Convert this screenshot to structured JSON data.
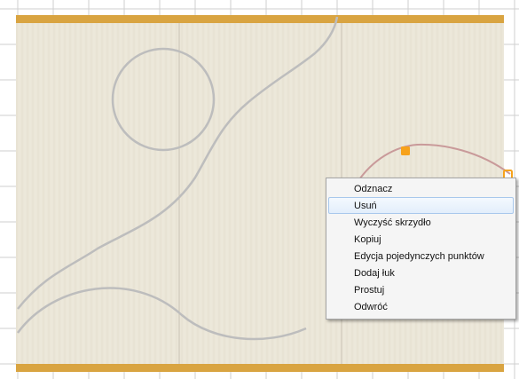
{
  "colors": {
    "panel": "#ebe6d8",
    "rail": "#d9a441",
    "grid": "#cfcfcf",
    "curve": "#bdbdbd",
    "arc": "#c99a9a",
    "handle": "#f7a21b"
  },
  "context_menu": {
    "items": [
      {
        "label": "Odznacz"
      },
      {
        "label": "Usuń",
        "highlighted": true
      },
      {
        "label": "Wyczyść skrzydło"
      },
      {
        "label": "Kopiuj"
      },
      {
        "label": "Edycja pojedynczych punktów"
      },
      {
        "label": "Dodaj łuk"
      },
      {
        "label": "Prostuj"
      },
      {
        "label": "Odwróć"
      }
    ]
  }
}
